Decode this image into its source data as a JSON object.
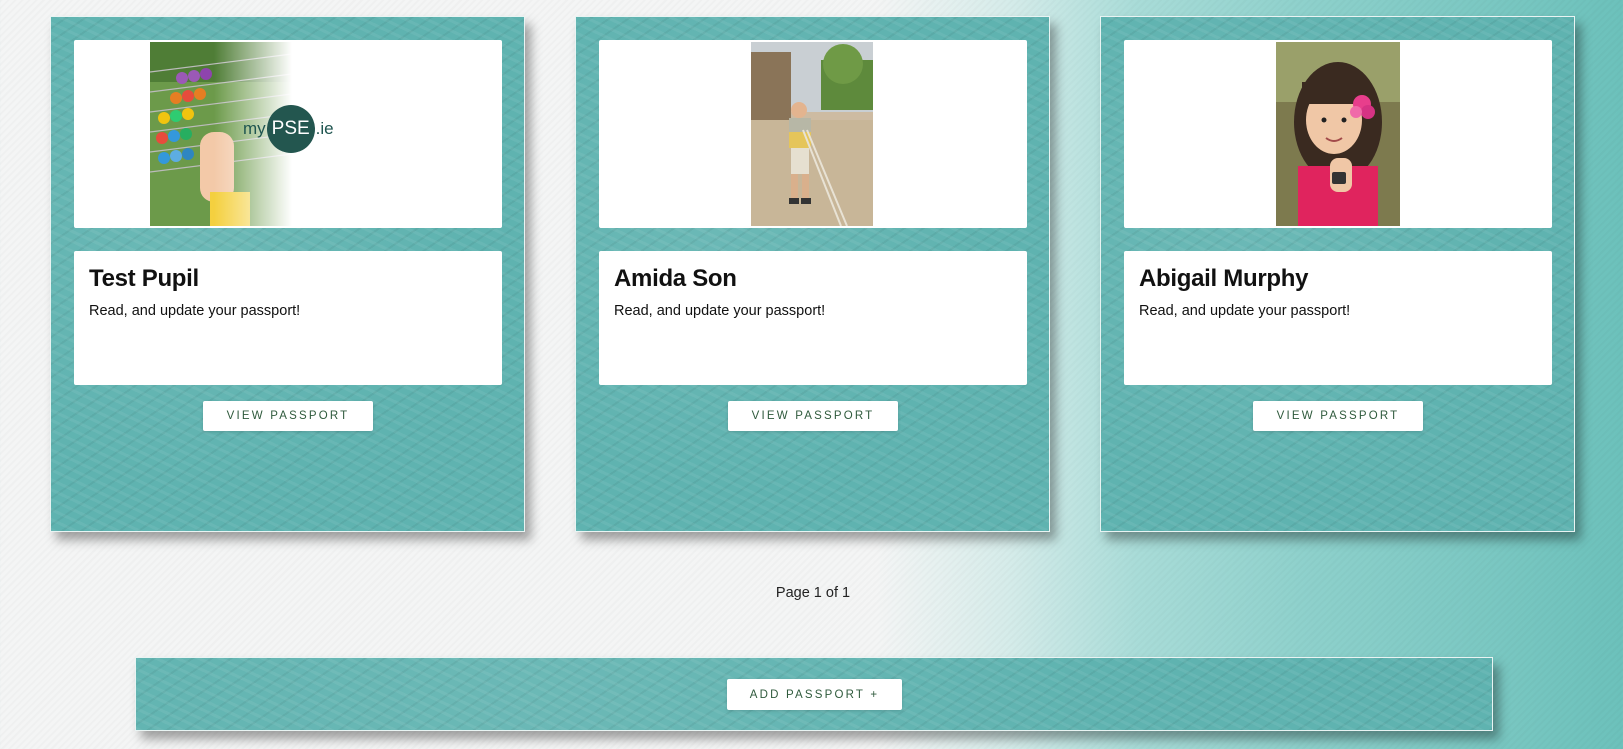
{
  "cards": [
    {
      "name": "Test Pupil",
      "description": "Read, and update your passport!",
      "button_label": "VIEW PASSPORT",
      "image": "abacus-with-mypse-logo",
      "logo": {
        "prefix": "my",
        "circle": "PSE",
        "suffix": ".ie"
      }
    },
    {
      "name": "Amida Son",
      "description": "Read, and update your passport!",
      "button_label": "VIEW PASSPORT",
      "image": "boy-standing-outdoors-photo"
    },
    {
      "name": "Abigail Murphy",
      "description": "Read, and update your passport!",
      "button_label": "VIEW PASSPORT",
      "image": "girl-with-flower-photo"
    }
  ],
  "pagination": {
    "text": "Page 1 of 1"
  },
  "add_button_label": "ADD PASSPORT +",
  "colors": {
    "panel_teal": "#5fb3b0",
    "button_text": "#2f5a3c",
    "logo_green": "#23564f"
  }
}
